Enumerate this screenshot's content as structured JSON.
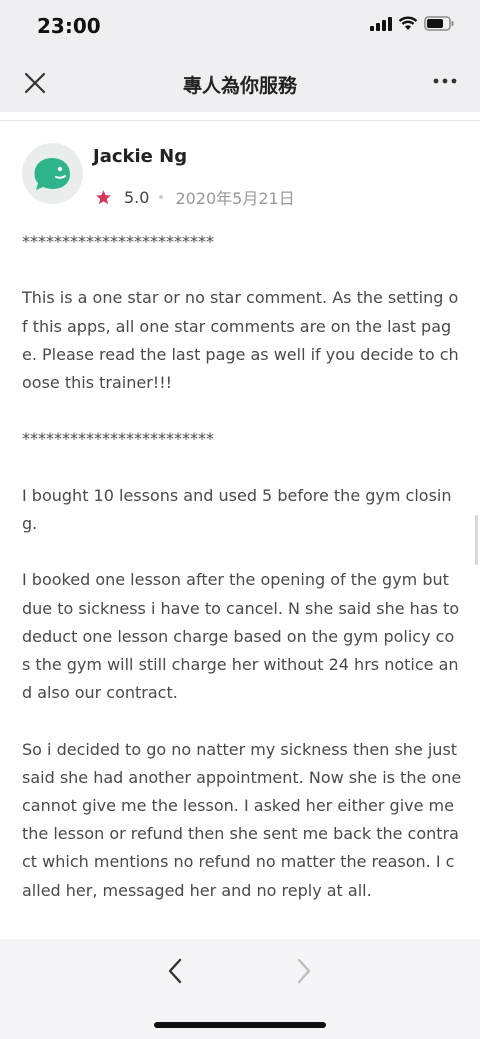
{
  "status_bar": {
    "time": "23:00",
    "icons": [
      "signal-icon",
      "wifi-icon",
      "battery-icon"
    ]
  },
  "nav": {
    "title": "專人為你服務",
    "close_icon": "close-icon",
    "more_icon": "more-icon"
  },
  "review": {
    "reviewer_name": "Jackie Ng",
    "rating": "5.0",
    "rating_fraction": 1.0,
    "date": "2020年5月21日",
    "avatar_color": "#2fb38a",
    "star_color": "#d6375f",
    "paragraphs": [
      "************************",
      "This is a one star or no star comment. As the setting of this apps, all one star comments are on the last page. Please read the last page as well if you decide to choose this trainer!!!",
      "************************",
      "I bought 10 lessons and used 5 before the gym closing.",
      "I booked one lesson after the opening of the gym but due to sickness i have to cancel. N she said she has to deduct one lesson charge based on the gym policy cos the gym will still charge her without 24 hrs notice and also our contract.",
      "So i decided to go no natter my sickness then she just said she had another appointment. Now she is the one cannot give me the lesson. I asked her either give me the lesson or refund then she sent me back the contract which mentions no refund no matter the reason. I called her, messaged her and no reply at all."
    ]
  },
  "bottom_nav": {
    "back_icon": "chevron-left-icon",
    "forward_icon": "chevron-right-icon"
  }
}
